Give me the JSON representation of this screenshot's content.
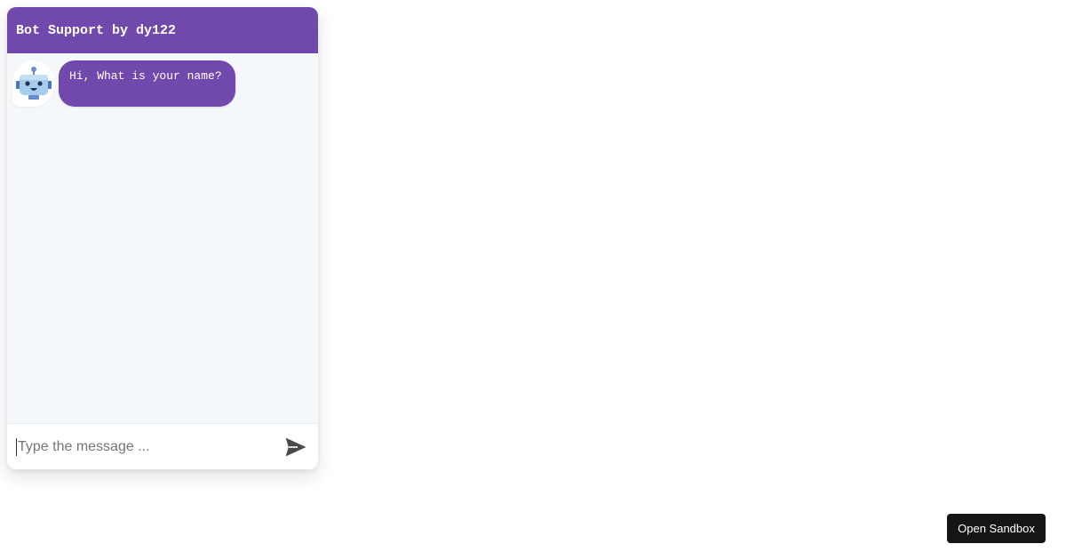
{
  "chatbot": {
    "header_title": "Bot Support by dy122",
    "messages": [
      {
        "sender": "bot",
        "text": "Hi, What is your name?"
      }
    ],
    "input_placeholder": "Type the message ...",
    "input_value": "",
    "send_icon": "send-icon",
    "avatar_icon": "robot-icon"
  },
  "sandbox": {
    "button_label": "Open Sandbox"
  },
  "colors": {
    "accent": "#7148ab",
    "body_bg": "#f5f8fb",
    "sandbox_bg": "#151515"
  }
}
